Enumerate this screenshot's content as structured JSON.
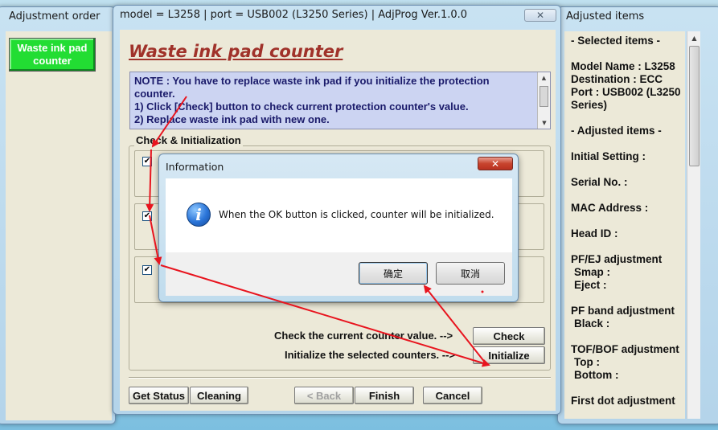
{
  "left_panel": {
    "title": "Adjustment order",
    "button_label": "Waste ink pad counter"
  },
  "main_window": {
    "title": "model = L3258 | port = USB002 (L3250 Series) | AdjProg Ver.1.0.0",
    "close_glyph": "✕",
    "heading": "Waste ink pad counter",
    "note": {
      "line1": "NOTE : You have to replace waste ink pad if you initialize the protection",
      "line2": "counter.",
      "line3": "1) Click [Check] button to check current protection counter's value.",
      "line4": "2) Replace waste ink pad with new one."
    },
    "group_title": "Check & Initialization",
    "check_glyph": "✔",
    "check_prompt": "Check the current counter value. -->",
    "init_prompt": "Initialize the selected counters. -->",
    "check_button": "Check",
    "init_button": "Initialize",
    "footer": {
      "get_status": "Get Status",
      "cleaning": "Cleaning",
      "back": "< Back",
      "finish": "Finish",
      "cancel": "Cancel"
    }
  },
  "dialog": {
    "title": "Information",
    "close_glyph": "✕",
    "info_glyph": "i",
    "message": "When the OK button is clicked, counter will be initialized.",
    "ok_button": "确定",
    "cancel_button": "取消"
  },
  "right_panel": {
    "title": "Adjusted items",
    "lines": [
      "- Selected items -",
      "",
      "Model Name : L3258",
      "Destination : ECC",
      "Port : USB002 (L3250",
      "Series)",
      "",
      "- Adjusted items -",
      "",
      "Initial Setting :",
      "",
      "Serial No. :",
      "",
      "MAC Address :",
      "",
      "Head ID :",
      "",
      "PF/EJ adjustment",
      " Smap :",
      " Eject :",
      "",
      "PF band adjustment",
      " Black :",
      "",
      "TOF/BOF adjustment",
      " Top :",
      " Bottom :",
      "",
      "First dot adjustment"
    ]
  },
  "colors": {
    "heading": "#a0322a",
    "note_bg": "#ccd4f2",
    "arrow": "#e8141e",
    "green_button": "#22dd33"
  }
}
